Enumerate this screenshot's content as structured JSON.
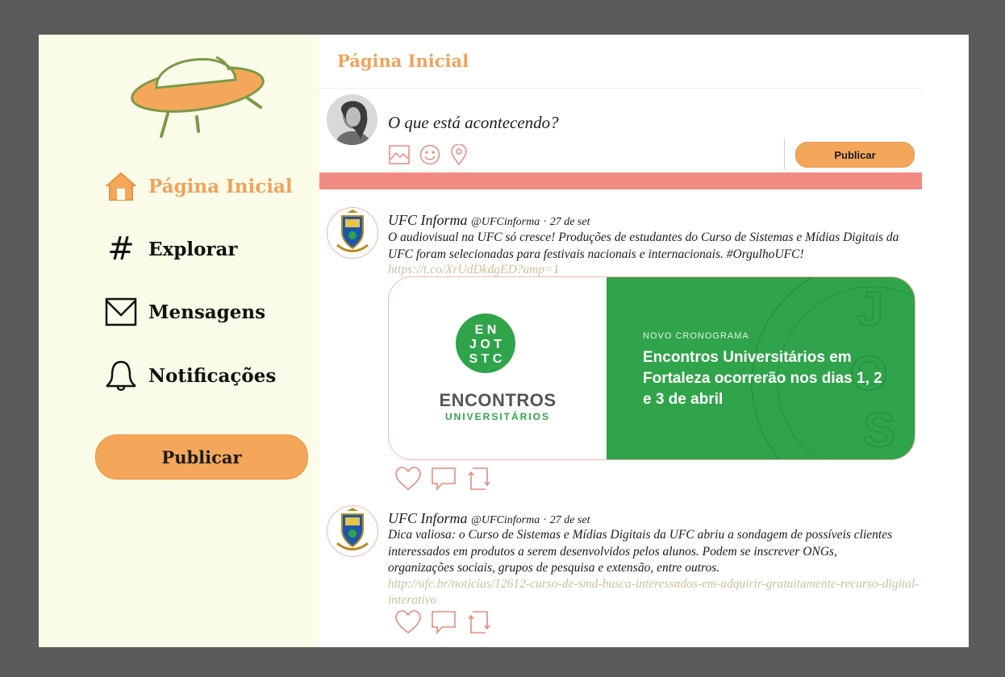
{
  "sidebar": {
    "logo_icon": "ufo-icon",
    "nav": [
      {
        "label": "Página Inicial",
        "icon": "home-icon",
        "active": true
      },
      {
        "label": "Explorar",
        "icon": "hash-icon"
      },
      {
        "label": "Mensagens",
        "icon": "envelope-icon"
      },
      {
        "label": "Notificações",
        "icon": "bell-icon"
      }
    ],
    "publish_label": "Publicar"
  },
  "main": {
    "title": "Página Inicial",
    "compose": {
      "placeholder": "O que está acontecendo?",
      "icons": [
        "image-icon",
        "emoji-icon",
        "location-icon"
      ],
      "publish_label": "Publicar"
    },
    "posts": [
      {
        "author": "UFC Informa",
        "handle": "@UFCinforma",
        "separator": "·",
        "date": "27 de set",
        "text": "O audiovisual na UFC só cresce! Produções de estudantes do Curso de Sistemas e Mídias Digitais da UFC foram selecionadas para festivais nacionais e internacionais. #OrgulhoUFC!",
        "link": "https://t.co/XrUdDkdgED?amp=1",
        "image": {
          "logo_text": "ENCONTROS",
          "logo_subtext": "UNIVERSITÁRIOS",
          "kicker": "NOVO CRONOGRAMA",
          "headline": "Encontros Universitários em Fortaleza ocorrerão nos dias 1, 2 e 3 de abril"
        },
        "actions": [
          "heart-icon",
          "comment-icon",
          "repost-icon"
        ]
      },
      {
        "author": "UFC Informa",
        "handle": "@UFCinforma",
        "separator": "·",
        "date": "27 de set",
        "text": "Dica valiosa: o Curso de Sistemas e Mídias Digitais da UFC abriu a sondagem de possíveis clientes interessados em produtos a serem desenvolvidos pelos alunos. Podem se inscrever ONGs, organizações sociais, grupos de pesquisa e extensão, entre outros.",
        "link": "http://ufc.br/noticias/12612-curso-de-smd-busca-interessados-em-adquirir-gratuitamente-recurso-digital-interativo",
        "actions": [
          "heart-icon",
          "comment-icon",
          "repost-icon"
        ]
      }
    ]
  },
  "colors": {
    "frame": "#5b5b5d",
    "sidebar_bg": "#fbfbe9",
    "accent_orange": "#f4a75b",
    "accent_text": "#f0a35a",
    "pink_bar": "#f28b82",
    "green": "#2fa44a",
    "ufo_green": "#7a9a48"
  }
}
